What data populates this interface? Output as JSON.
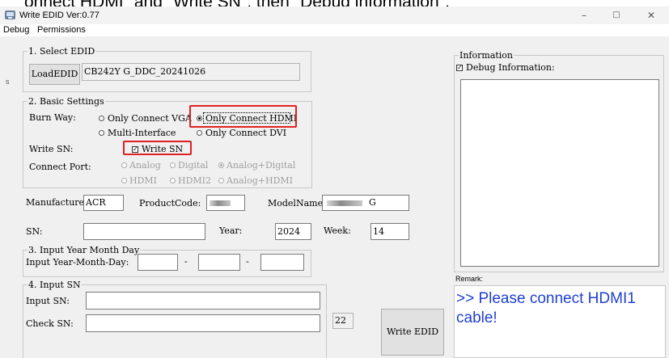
{
  "header_fragment": "onnect HDMI\" and \"Write SN\", then \"Debug information\".",
  "window": {
    "title": "Write EDID  Ver:0.77",
    "controls": [
      "–",
      "□",
      "✕"
    ]
  },
  "menu": [
    "Debug",
    "Permissions"
  ],
  "select_edid": {
    "legend": "1. Select EDID",
    "button": "LoadEDID",
    "value": "CB242Y G_DDC_20241026"
  },
  "basic": {
    "legend": "2. Basic Settings",
    "burn_way_label": "Burn Way:",
    "burn_options": [
      "Only Connect VGA",
      "Only Connect HDMI",
      "Multi-Interface",
      "Only Connect DVI"
    ],
    "write_sn_label": "Write SN:",
    "write_sn_check": "Write SN",
    "connect_port_label": "Connect Port:",
    "port_options": [
      "Analog",
      "Digital",
      "Analog+Digital",
      "HDMI",
      "HDMI2",
      "Analog+HDMI"
    ]
  },
  "fields": {
    "manufacture_label": "Manufacture",
    "manufacture_value": "ACR",
    "productcode_label": "ProductCode:",
    "modelname_label": "ModelName:",
    "modelname_suffix": "G",
    "sn_label": "SN:",
    "year_label": "Year:",
    "year_value": "2024",
    "week_label": "Week:",
    "week_value": "14"
  },
  "year_month_day": {
    "legend": "3. Input Year Month Day",
    "label": "Input Year-Month-Day:",
    "sep": "-"
  },
  "input_sn": {
    "legend": "4. Input SN",
    "input_label": "Input SN:",
    "check_label": "Check SN:",
    "count": "22"
  },
  "write_button": "Write EDID",
  "info": {
    "legend": "Information",
    "debug_check": "Debug Information:"
  },
  "remark": {
    "label": "Remark:",
    "message": ">> Please connect HDMI1 cable!",
    "color": "#1f3fd0"
  },
  "highlight_color": "#e02020",
  "side_glyph": "s"
}
